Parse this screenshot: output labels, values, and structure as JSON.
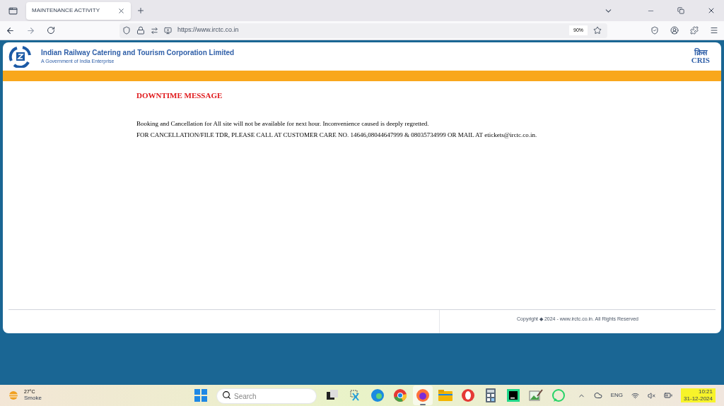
{
  "browser": {
    "tabs": [
      {
        "title": "MAINTENANCE ACTIVITY",
        "selected": true
      }
    ],
    "url": "https://www.irctc.co.in",
    "zoom": "90%"
  },
  "page": {
    "org_name": "Indian Railway Catering and Tourism Corporation Limited",
    "org_subtitle": "A Government of India Enterprise",
    "partner_logo_hindi": "क्रिस",
    "partner_logo": "CRIS",
    "message": {
      "title": "DOWNTIME MESSAGE",
      "lines": [
        "Booking and Cancellation for All site will not be available for next hour. Inconvenience caused is deeply regretted.",
        "FOR CANCELLATION/FILE TDR, PLEASE CALL AT CUSTOMER CARE NO. 14646,08044647999 & 08035734999 OR MAIL AT etickets@irctc.co.in."
      ]
    },
    "copyright": "Copyright ◆ 2024 - www.irctc.co.in. All Rights Reserved"
  },
  "taskbar": {
    "weather": {
      "temperature": "27°C",
      "condition": "Smoke"
    },
    "search_placeholder": "Search",
    "apps": [
      {
        "kind": "start"
      },
      {
        "kind": "search"
      },
      {
        "kind": "taskview"
      },
      {
        "kind": "snip"
      },
      {
        "kind": "edge"
      },
      {
        "kind": "chrome"
      },
      {
        "kind": "firefox",
        "selected": true
      },
      {
        "kind": "folder"
      },
      {
        "kind": "opera"
      },
      {
        "kind": "calculator"
      },
      {
        "kind": "pycharm"
      },
      {
        "kind": "paint"
      },
      {
        "kind": "whatsapp"
      }
    ],
    "language": "ENG",
    "time": "10:21",
    "date": "31-12-2024"
  }
}
